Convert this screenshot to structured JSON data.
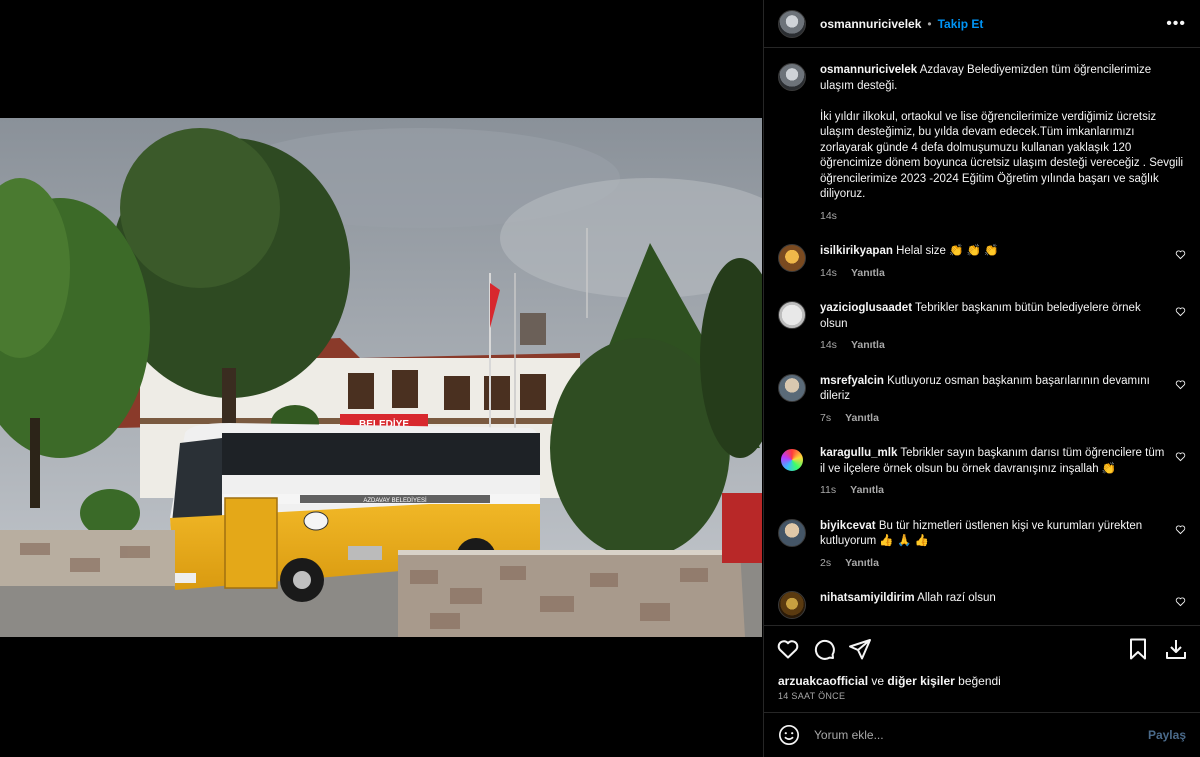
{
  "post": {
    "username": "osmannuricivelek",
    "follow_label": "Takip Et",
    "more_label": "•••"
  },
  "caption": {
    "username": "osmannuricivelek",
    "text_1": "Azdavay Belediyemizden tüm öğrencilerimize ulaşım desteği.",
    "text_2": "İki yıldır ilkokul, ortaokul ve lise öğrencilerimize verdiğimiz ücretsiz ulaşım desteğimiz, bu yılda devam edecek.Tüm imkanlarımızı zorlayarak günde 4 defa dolmuşumuzu kullanan yaklaşık 120 öğrencimize dönem boyunca ücretsiz ulaşım desteği vereceğiz . Sevgili öğrencilerimize 2023 -2024 Eğitim Öğretim yılında başarı ve sağlık diliyoruz.",
    "time": "14s"
  },
  "photo": {
    "building_sign": "BELEDİYE",
    "bus_text": "AZDAVAY BELEDİYESİ"
  },
  "comments": [
    {
      "user": "isilkirikyapan",
      "text": "Helal size 👏 👏 👏",
      "time": "14s",
      "reply": "Yanıtla"
    },
    {
      "user": "yazicioglusaadet",
      "text": "Tebrikler başkanım bütün belediyelere örnek olsun",
      "time": "14s",
      "reply": "Yanıtla"
    },
    {
      "user": "msrefyalcin",
      "text": "Kutluyoruz osman başkanım başarılarının devamını dileriz",
      "time": "7s",
      "reply": "Yanıtla"
    },
    {
      "user": "karagullu_mlk",
      "text": "Tebrikler sayın başkanım darısı tüm öğrencilere tüm il ve ilçelere örnek olsun bu örnek davranışınız inşallah 👏",
      "time": "11s",
      "reply": "Yanıtla"
    },
    {
      "user": "biyikcevat",
      "text": "Bu tür hizmetleri üstlenen kişi ve kurumları yürekten kutluyorum 👍 🙏 👍",
      "time": "2s",
      "reply": "Yanıtla"
    },
    {
      "user": "nihatsamiyildirim",
      "text": "Allah razí olsun",
      "time": "",
      "reply": ""
    }
  ],
  "likes": {
    "user": "arzuakcaofficial",
    "rest": "ve",
    "others": "diğer kişiler",
    "suffix": "beğendi"
  },
  "post_time": "14 SAAT ÖNCE",
  "add_comment": {
    "placeholder": "Yorum ekle...",
    "share_label": "Paylaş"
  },
  "colors": {
    "accent": "#0095f6",
    "background": "#000000",
    "border": "#262626",
    "muted": "#a8a8a8"
  },
  "icons": [
    "more-icon",
    "heart-icon",
    "comment-icon",
    "share-icon",
    "bookmark-icon",
    "download-icon",
    "emoji-icon"
  ]
}
